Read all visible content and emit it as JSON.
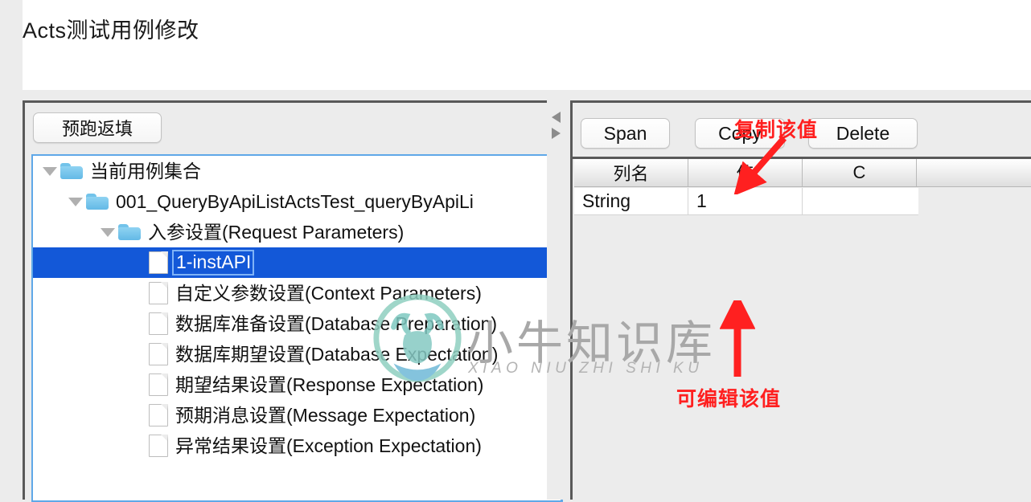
{
  "window": {
    "title": "Acts测试用例修改"
  },
  "left_panel": {
    "prefill_button": "预跑返填",
    "tree": [
      {
        "label": "当前用例集合",
        "type": "folder",
        "depth": 0,
        "expanded": true,
        "selected": false
      },
      {
        "label": "001_QueryByApiListActsTest_queryByApiLi",
        "type": "folder",
        "depth": 1,
        "expanded": true,
        "selected": false
      },
      {
        "label": "入参设置(Request Parameters)",
        "type": "folder",
        "depth": 2,
        "expanded": true,
        "selected": false
      },
      {
        "label": "1-instAPI",
        "type": "file",
        "depth": 3,
        "expanded": false,
        "selected": true
      },
      {
        "label": "自定义参数设置(Context Parameters)",
        "type": "file",
        "depth": 3,
        "expanded": false,
        "selected": false
      },
      {
        "label": "数据库准备设置(Database Preparation)",
        "type": "file",
        "depth": 3,
        "expanded": false,
        "selected": false
      },
      {
        "label": "数据库期望设置(Database Expectation)",
        "type": "file",
        "depth": 3,
        "expanded": false,
        "selected": false
      },
      {
        "label": "期望结果设置(Response Expectation)",
        "type": "file",
        "depth": 3,
        "expanded": false,
        "selected": false
      },
      {
        "label": "预期消息设置(Message Expectation)",
        "type": "file",
        "depth": 3,
        "expanded": false,
        "selected": false
      },
      {
        "label": "异常结果设置(Exception Expectation)",
        "type": "file",
        "depth": 3,
        "expanded": false,
        "selected": false
      }
    ]
  },
  "splitter": {
    "collapse_left_icon": "triangle-left-icon",
    "collapse_right_icon": "triangle-right-icon"
  },
  "right_panel": {
    "toolbar": {
      "span_label": "Span",
      "copy_label": "Copy",
      "delete_label": "Delete"
    },
    "table": {
      "headers": [
        "列名",
        "值",
        "C",
        ""
      ],
      "rows": [
        [
          "String",
          "1",
          "",
          ""
        ]
      ]
    }
  },
  "annotations": [
    {
      "text": "复制该值",
      "color": "#ff1f1f",
      "points_to": "copy-button"
    },
    {
      "text": "可编辑该值",
      "color": "#ff1f1f",
      "points_to": "value-cell"
    }
  ],
  "watermark": {
    "chinese": "小牛知识库",
    "pinyin": "XIAO NIU ZHI SHI KU",
    "logo_icon": "bull-logo-icon"
  }
}
